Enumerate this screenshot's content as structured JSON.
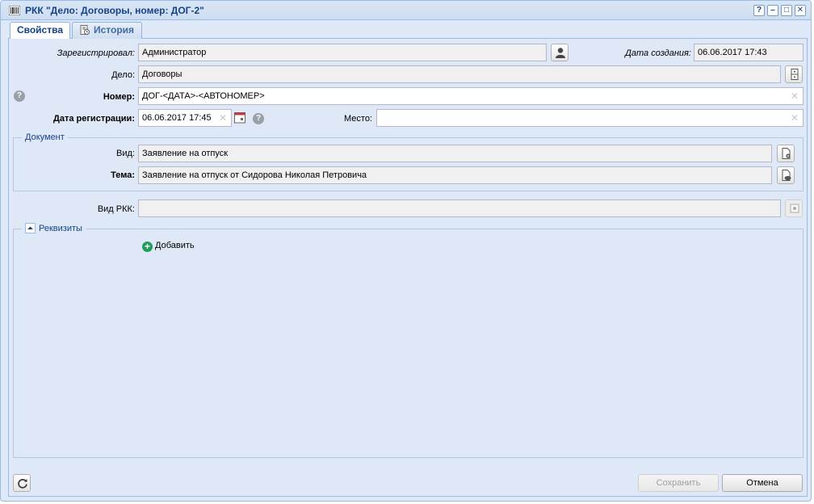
{
  "window": {
    "title": "РКК \"Дело: Договоры, номер: ДОГ-2\"",
    "tools": {
      "help": "?",
      "minimize": "–",
      "maximize": "□",
      "close": "✕"
    }
  },
  "tabs": [
    {
      "label": "Свойства",
      "active": true
    },
    {
      "label": "История",
      "active": false,
      "icon": "history-doc-icon"
    }
  ],
  "form": {
    "registered_by": {
      "label": "Зарегистрировал:",
      "value": "Администратор"
    },
    "created_date": {
      "label": "Дата создания:",
      "value": "06.06.2017 17:43"
    },
    "case": {
      "label": "Дело:",
      "value": "Договоры"
    },
    "number": {
      "label": "Номер:",
      "value": "ДОГ-<ДАТА>-<АВТОНОМЕР>"
    },
    "reg_date": {
      "label": "Дата регистрации:",
      "value": "06.06.2017 17:45"
    },
    "place": {
      "label": "Место:",
      "value": ""
    },
    "document": {
      "legend": "Документ",
      "kind": {
        "label": "Вид:",
        "value": "Заявление на отпуск"
      },
      "topic": {
        "label": "Тема:",
        "value": "Заявление на отпуск от Сидорова Николая Петровича"
      }
    },
    "rkk_kind": {
      "label": "Вид РКК:",
      "value": ""
    },
    "requisites": {
      "legend": "Реквизиты",
      "add_label": "Добавить"
    }
  },
  "footer": {
    "save_label": "Сохранить",
    "save_enabled": false,
    "cancel_label": "Отмена"
  },
  "colors": {
    "title_text": "#15428b",
    "panel_bg": "#dfe8f6",
    "border": "#99bbe8",
    "add_icon": "#1e9e5a"
  }
}
